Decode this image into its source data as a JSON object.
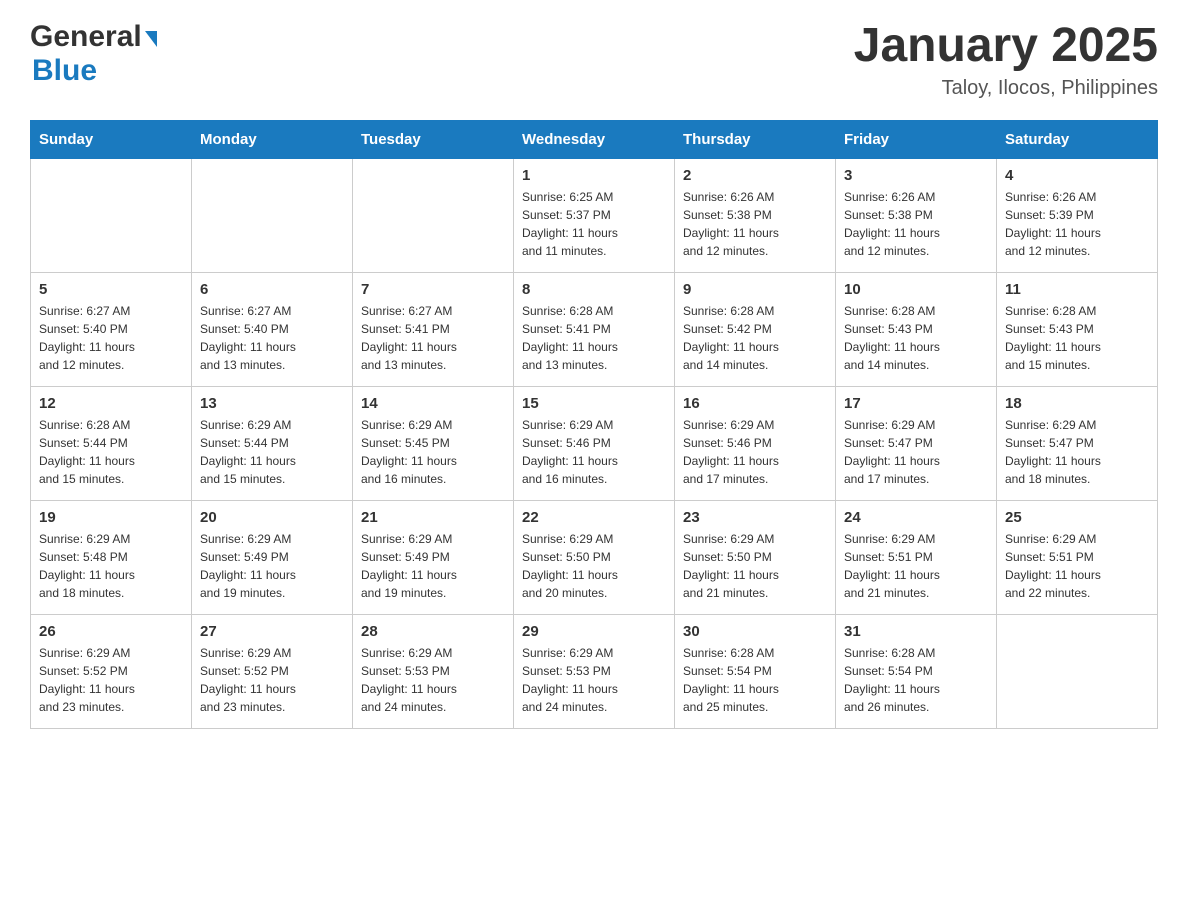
{
  "header": {
    "logo_general": "General",
    "logo_blue": "Blue",
    "month_title": "January 2025",
    "location": "Taloy, Ilocos, Philippines"
  },
  "calendar": {
    "days": [
      "Sunday",
      "Monday",
      "Tuesday",
      "Wednesday",
      "Thursday",
      "Friday",
      "Saturday"
    ],
    "weeks": [
      [
        {
          "day": "",
          "info": ""
        },
        {
          "day": "",
          "info": ""
        },
        {
          "day": "",
          "info": ""
        },
        {
          "day": "1",
          "info": "Sunrise: 6:25 AM\nSunset: 5:37 PM\nDaylight: 11 hours\nand 11 minutes."
        },
        {
          "day": "2",
          "info": "Sunrise: 6:26 AM\nSunset: 5:38 PM\nDaylight: 11 hours\nand 12 minutes."
        },
        {
          "day": "3",
          "info": "Sunrise: 6:26 AM\nSunset: 5:38 PM\nDaylight: 11 hours\nand 12 minutes."
        },
        {
          "day": "4",
          "info": "Sunrise: 6:26 AM\nSunset: 5:39 PM\nDaylight: 11 hours\nand 12 minutes."
        }
      ],
      [
        {
          "day": "5",
          "info": "Sunrise: 6:27 AM\nSunset: 5:40 PM\nDaylight: 11 hours\nand 12 minutes."
        },
        {
          "day": "6",
          "info": "Sunrise: 6:27 AM\nSunset: 5:40 PM\nDaylight: 11 hours\nand 13 minutes."
        },
        {
          "day": "7",
          "info": "Sunrise: 6:27 AM\nSunset: 5:41 PM\nDaylight: 11 hours\nand 13 minutes."
        },
        {
          "day": "8",
          "info": "Sunrise: 6:28 AM\nSunset: 5:41 PM\nDaylight: 11 hours\nand 13 minutes."
        },
        {
          "day": "9",
          "info": "Sunrise: 6:28 AM\nSunset: 5:42 PM\nDaylight: 11 hours\nand 14 minutes."
        },
        {
          "day": "10",
          "info": "Sunrise: 6:28 AM\nSunset: 5:43 PM\nDaylight: 11 hours\nand 14 minutes."
        },
        {
          "day": "11",
          "info": "Sunrise: 6:28 AM\nSunset: 5:43 PM\nDaylight: 11 hours\nand 15 minutes."
        }
      ],
      [
        {
          "day": "12",
          "info": "Sunrise: 6:28 AM\nSunset: 5:44 PM\nDaylight: 11 hours\nand 15 minutes."
        },
        {
          "day": "13",
          "info": "Sunrise: 6:29 AM\nSunset: 5:44 PM\nDaylight: 11 hours\nand 15 minutes."
        },
        {
          "day": "14",
          "info": "Sunrise: 6:29 AM\nSunset: 5:45 PM\nDaylight: 11 hours\nand 16 minutes."
        },
        {
          "day": "15",
          "info": "Sunrise: 6:29 AM\nSunset: 5:46 PM\nDaylight: 11 hours\nand 16 minutes."
        },
        {
          "day": "16",
          "info": "Sunrise: 6:29 AM\nSunset: 5:46 PM\nDaylight: 11 hours\nand 17 minutes."
        },
        {
          "day": "17",
          "info": "Sunrise: 6:29 AM\nSunset: 5:47 PM\nDaylight: 11 hours\nand 17 minutes."
        },
        {
          "day": "18",
          "info": "Sunrise: 6:29 AM\nSunset: 5:47 PM\nDaylight: 11 hours\nand 18 minutes."
        }
      ],
      [
        {
          "day": "19",
          "info": "Sunrise: 6:29 AM\nSunset: 5:48 PM\nDaylight: 11 hours\nand 18 minutes."
        },
        {
          "day": "20",
          "info": "Sunrise: 6:29 AM\nSunset: 5:49 PM\nDaylight: 11 hours\nand 19 minutes."
        },
        {
          "day": "21",
          "info": "Sunrise: 6:29 AM\nSunset: 5:49 PM\nDaylight: 11 hours\nand 19 minutes."
        },
        {
          "day": "22",
          "info": "Sunrise: 6:29 AM\nSunset: 5:50 PM\nDaylight: 11 hours\nand 20 minutes."
        },
        {
          "day": "23",
          "info": "Sunrise: 6:29 AM\nSunset: 5:50 PM\nDaylight: 11 hours\nand 21 minutes."
        },
        {
          "day": "24",
          "info": "Sunrise: 6:29 AM\nSunset: 5:51 PM\nDaylight: 11 hours\nand 21 minutes."
        },
        {
          "day": "25",
          "info": "Sunrise: 6:29 AM\nSunset: 5:51 PM\nDaylight: 11 hours\nand 22 minutes."
        }
      ],
      [
        {
          "day": "26",
          "info": "Sunrise: 6:29 AM\nSunset: 5:52 PM\nDaylight: 11 hours\nand 23 minutes."
        },
        {
          "day": "27",
          "info": "Sunrise: 6:29 AM\nSunset: 5:52 PM\nDaylight: 11 hours\nand 23 minutes."
        },
        {
          "day": "28",
          "info": "Sunrise: 6:29 AM\nSunset: 5:53 PM\nDaylight: 11 hours\nand 24 minutes."
        },
        {
          "day": "29",
          "info": "Sunrise: 6:29 AM\nSunset: 5:53 PM\nDaylight: 11 hours\nand 24 minutes."
        },
        {
          "day": "30",
          "info": "Sunrise: 6:28 AM\nSunset: 5:54 PM\nDaylight: 11 hours\nand 25 minutes."
        },
        {
          "day": "31",
          "info": "Sunrise: 6:28 AM\nSunset: 5:54 PM\nDaylight: 11 hours\nand 26 minutes."
        },
        {
          "day": "",
          "info": ""
        }
      ]
    ]
  }
}
